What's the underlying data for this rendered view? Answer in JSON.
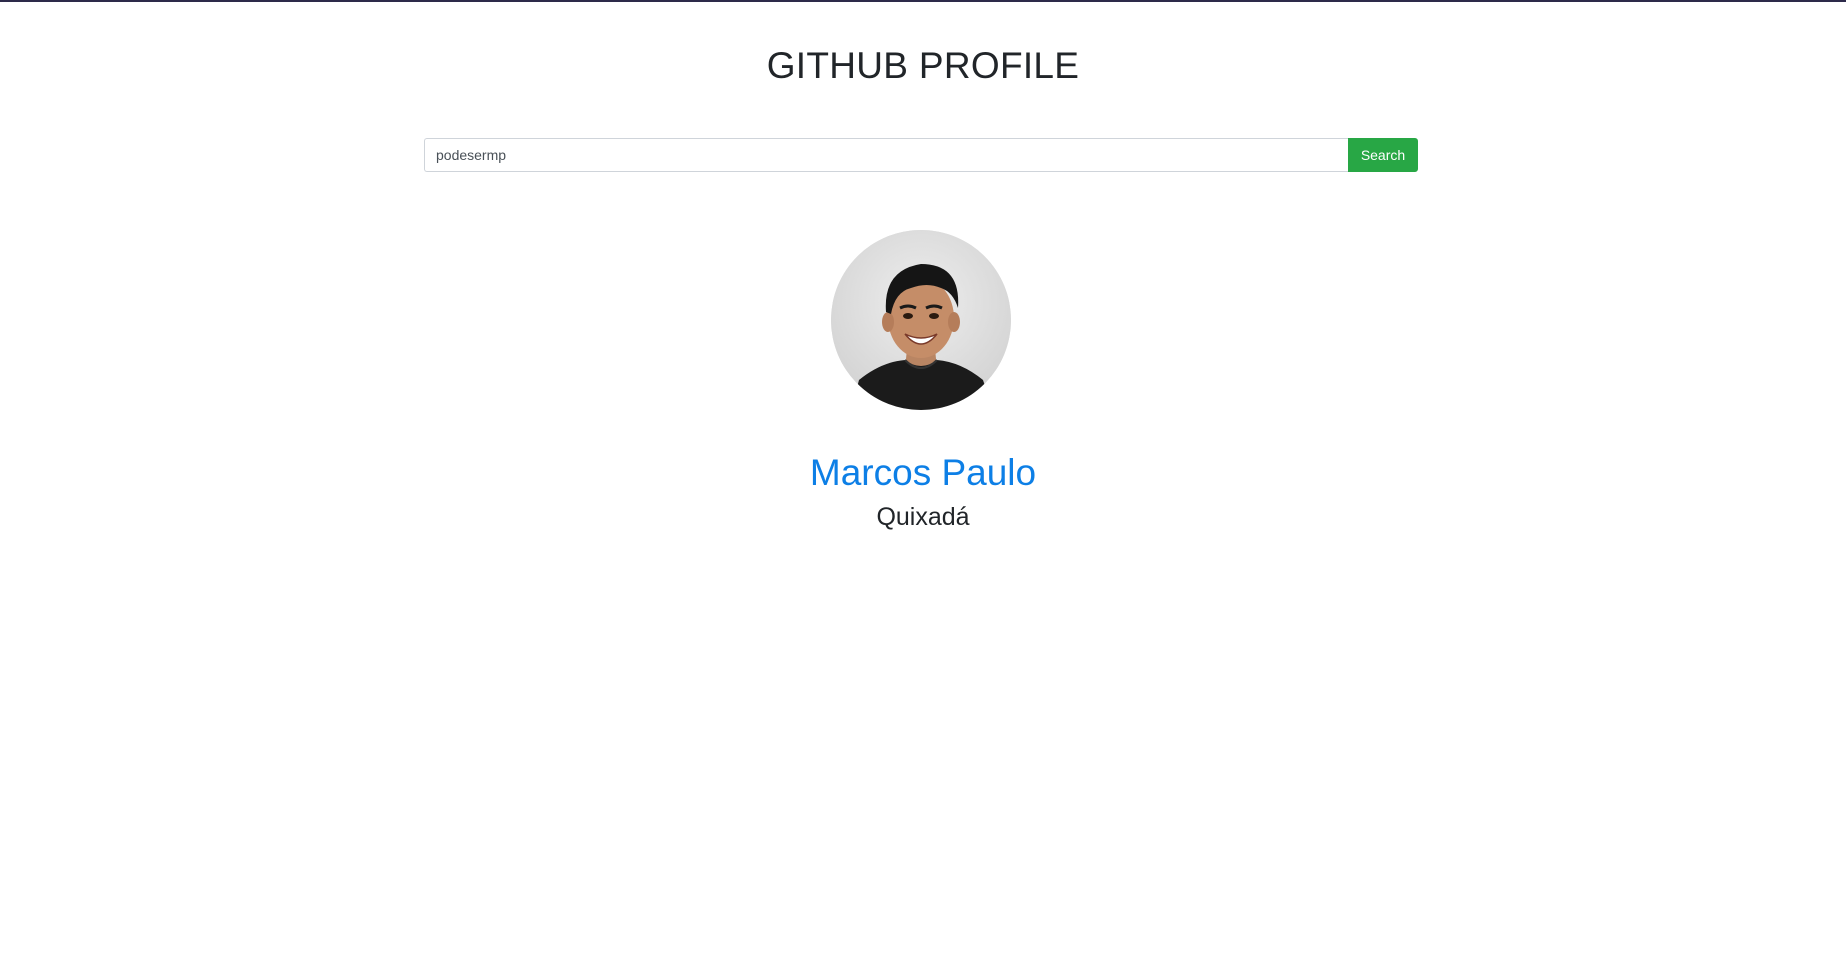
{
  "header": {
    "title": "GITHUB PROFILE"
  },
  "search": {
    "value": "podesermp",
    "button_label": "Search"
  },
  "profile": {
    "avatar_icon": "user-photo",
    "name": "Marcos Paulo",
    "location": "Quixadá"
  },
  "colors": {
    "accent_link": "#0d7fe6",
    "search_button": "#28a745",
    "top_border": "#2d2a4a"
  }
}
